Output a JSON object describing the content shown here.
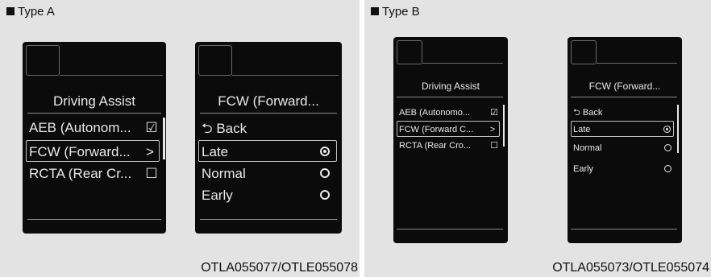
{
  "type_a": {
    "title": "Type A",
    "caption": "OTLA055077/OTLE055078",
    "screen1": {
      "title": "Driving Assist",
      "items": [
        {
          "label": "AEB (Autonom...",
          "control": "☑"
        },
        {
          "label": "FCW (Forward...",
          "control": ">"
        },
        {
          "label": "RCTA (Rear Cr...",
          "control": "☐"
        }
      ]
    },
    "screen2": {
      "title": "FCW (Forward...",
      "back_label": "⮌ Back",
      "options": [
        {
          "label": "Late",
          "selected": true
        },
        {
          "label": "Normal",
          "selected": false
        },
        {
          "label": "Early",
          "selected": false
        }
      ]
    }
  },
  "type_b": {
    "title": "Type B",
    "caption": "OTLA055073/OTLE055074",
    "screen1": {
      "title": "Driving Assist",
      "items": [
        {
          "label": "AEB (Autonomo...",
          "control": "☑"
        },
        {
          "label": "FCW (Forward C...",
          "control": ">"
        },
        {
          "label": "RCTA (Rear Cro...",
          "control": "☐"
        }
      ]
    },
    "screen2": {
      "title": "FCW (Forward...",
      "back_label": "⮌ Back",
      "options": [
        {
          "label": "Late",
          "selected": true
        },
        {
          "label": "Normal",
          "selected": false
        },
        {
          "label": "Early",
          "selected": false
        }
      ]
    }
  },
  "colors": {
    "screen_bg": "#0b0b0b",
    "panel_bg": "#e3e3e3",
    "text": "#e8e8e8"
  }
}
